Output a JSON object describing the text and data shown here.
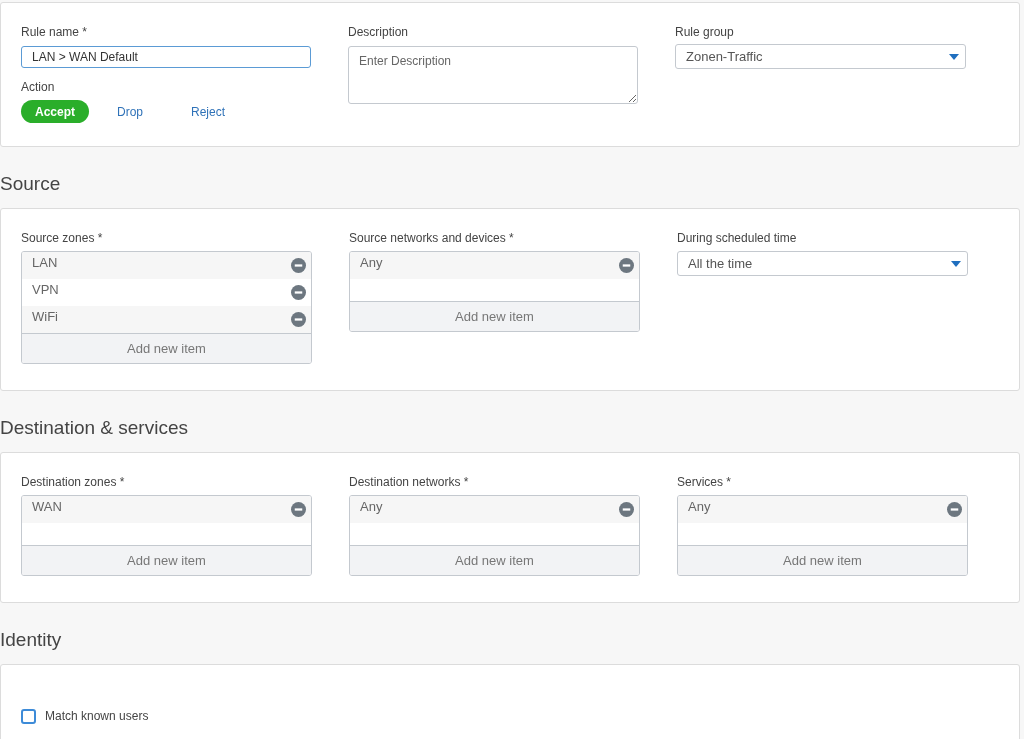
{
  "general": {
    "rule_name": {
      "label": "Rule name *",
      "value": "LAN > WAN Default"
    },
    "action": {
      "label": "Action",
      "options": [
        {
          "label": "Accept",
          "selected": true
        },
        {
          "label": "Drop",
          "selected": false
        },
        {
          "label": "Reject",
          "selected": false
        }
      ]
    },
    "description": {
      "label": "Description",
      "placeholder": "Enter Description"
    },
    "rule_group": {
      "label": "Rule group",
      "value": "Zonen-Traffic"
    }
  },
  "sections": [
    {
      "title": "Source",
      "fields": [
        {
          "kind": "list",
          "label": "Source zones *",
          "items": [
            "LAN",
            "VPN",
            "WiFi"
          ],
          "add_label": "Add new item"
        },
        {
          "kind": "list",
          "label": "Source networks and devices *",
          "items": [
            "Any"
          ],
          "add_label": "Add new item"
        },
        {
          "kind": "select",
          "label": "During scheduled time",
          "value": "All the time"
        }
      ]
    },
    {
      "title": "Destination & services",
      "fields": [
        {
          "kind": "list",
          "label": "Destination zones *",
          "items": [
            "WAN"
          ],
          "add_label": "Add new item"
        },
        {
          "kind": "list",
          "label": "Destination networks *",
          "items": [
            "Any"
          ],
          "add_label": "Add new item"
        },
        {
          "kind": "list",
          "label": "Services *",
          "items": [
            "Any"
          ],
          "add_label": "Add new item"
        }
      ]
    },
    {
      "title": "Identity",
      "fields": [
        {
          "kind": "checkbox",
          "label": "Match known users",
          "checked": false
        }
      ]
    }
  ]
}
